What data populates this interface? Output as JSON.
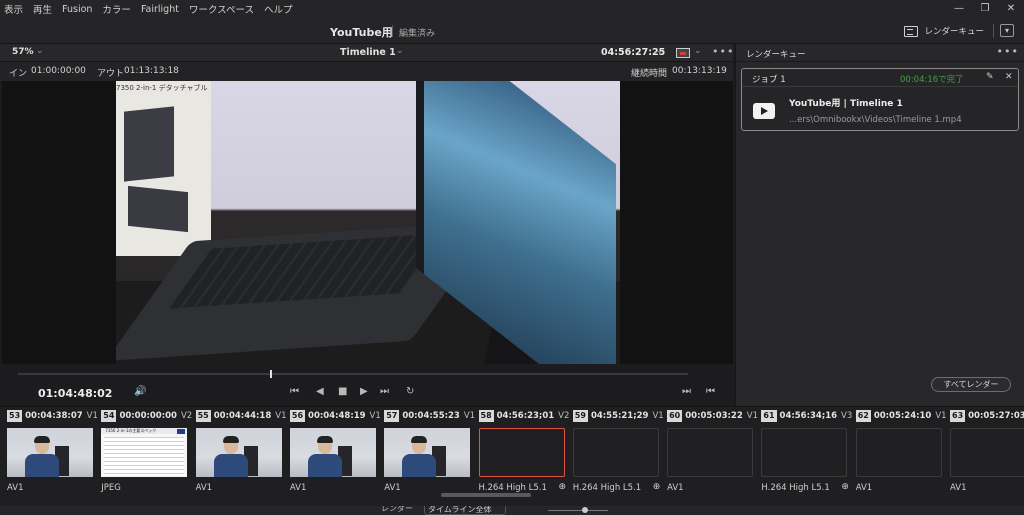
{
  "menu": [
    "表示",
    "再生",
    "Fusion",
    "カラー",
    "Fairlight",
    "ワークスペース",
    "ヘルプ"
  ],
  "window_controls": {
    "minimize": "—",
    "restore": "❐",
    "close": "✕"
  },
  "title_bar": {
    "project": "YouTube用",
    "status": "編集済み",
    "render_queue_label": "レンダーキュー",
    "collapse": "▾"
  },
  "viewer_toolbar": {
    "zoom": "57%",
    "timeline": "Timeline 1",
    "timecode": "04:56:27:25",
    "more": "•••"
  },
  "inout": {
    "in_label": "イン",
    "in_tc": "01:00:00:00",
    "out_label": "アウト",
    "out_tc": "01:13:13:18",
    "duration_label": "継続時間",
    "duration_tc": "00:13:13:19"
  },
  "preview": {
    "box_label": "7350 2-in-1 デタッチャブル"
  },
  "transport": {
    "current_tc": "01:04:48:02",
    "volume": "🔊",
    "first": "⏮",
    "prev": "◀",
    "stop": "■",
    "play": "▶",
    "last": "⏭",
    "loop": "↻",
    "next_clip": "⏭",
    "prev_clip": "⏮"
  },
  "render_queue": {
    "header": "レンダーキュー",
    "more": "•••",
    "job": {
      "name": "ジョブ 1",
      "status": "00:04:16で完了",
      "edit_icon": "✎",
      "close_icon": "✕",
      "title": "YouTube用 | Timeline 1",
      "path": "...ers\\Omnibookx\\Videos\\Timeline 1.mp4"
    },
    "render_all": "すべてレンダー"
  },
  "clips": [
    {
      "num": "53",
      "tc": "00:04:38:07",
      "track": "V1",
      "codec": "AV1",
      "thumb": "video"
    },
    {
      "num": "54",
      "tc": "00:00:00:00",
      "track": "V2",
      "codec": "JPEG",
      "thumb": "doc"
    },
    {
      "num": "55",
      "tc": "00:04:44:18",
      "track": "V1",
      "codec": "AV1",
      "thumb": "video"
    },
    {
      "num": "56",
      "tc": "00:04:48:19",
      "track": "V1",
      "codec": "AV1",
      "thumb": "video"
    },
    {
      "num": "57",
      "tc": "00:04:55:23",
      "track": "V1",
      "codec": "AV1",
      "thumb": "video"
    },
    {
      "num": "58",
      "tc": "04:56:23;01",
      "track": "V2",
      "codec": "H.264 High L5.1",
      "thumb": "selected"
    },
    {
      "num": "59",
      "tc": "04:55:21;29",
      "track": "V1",
      "codec": "H.264 High L5.1",
      "thumb": "empty"
    },
    {
      "num": "60",
      "tc": "00:05:03:22",
      "track": "V1",
      "codec": "AV1",
      "thumb": "empty"
    },
    {
      "num": "61",
      "tc": "04:56:34;16",
      "track": "V3",
      "codec": "H.264 High L5.1",
      "thumb": "empty"
    },
    {
      "num": "62",
      "tc": "00:05:24:10",
      "track": "V1",
      "codec": "AV1",
      "thumb": "empty"
    },
    {
      "num": "63",
      "tc": "00:05:27:03",
      "track": "",
      "codec": "AV1",
      "thumb": "empty"
    }
  ],
  "doc_thumb_title": "7350 2-in-1の主要スペック",
  "bottom_bar": {
    "label": "レンダー",
    "select": "タイムライン全体"
  }
}
